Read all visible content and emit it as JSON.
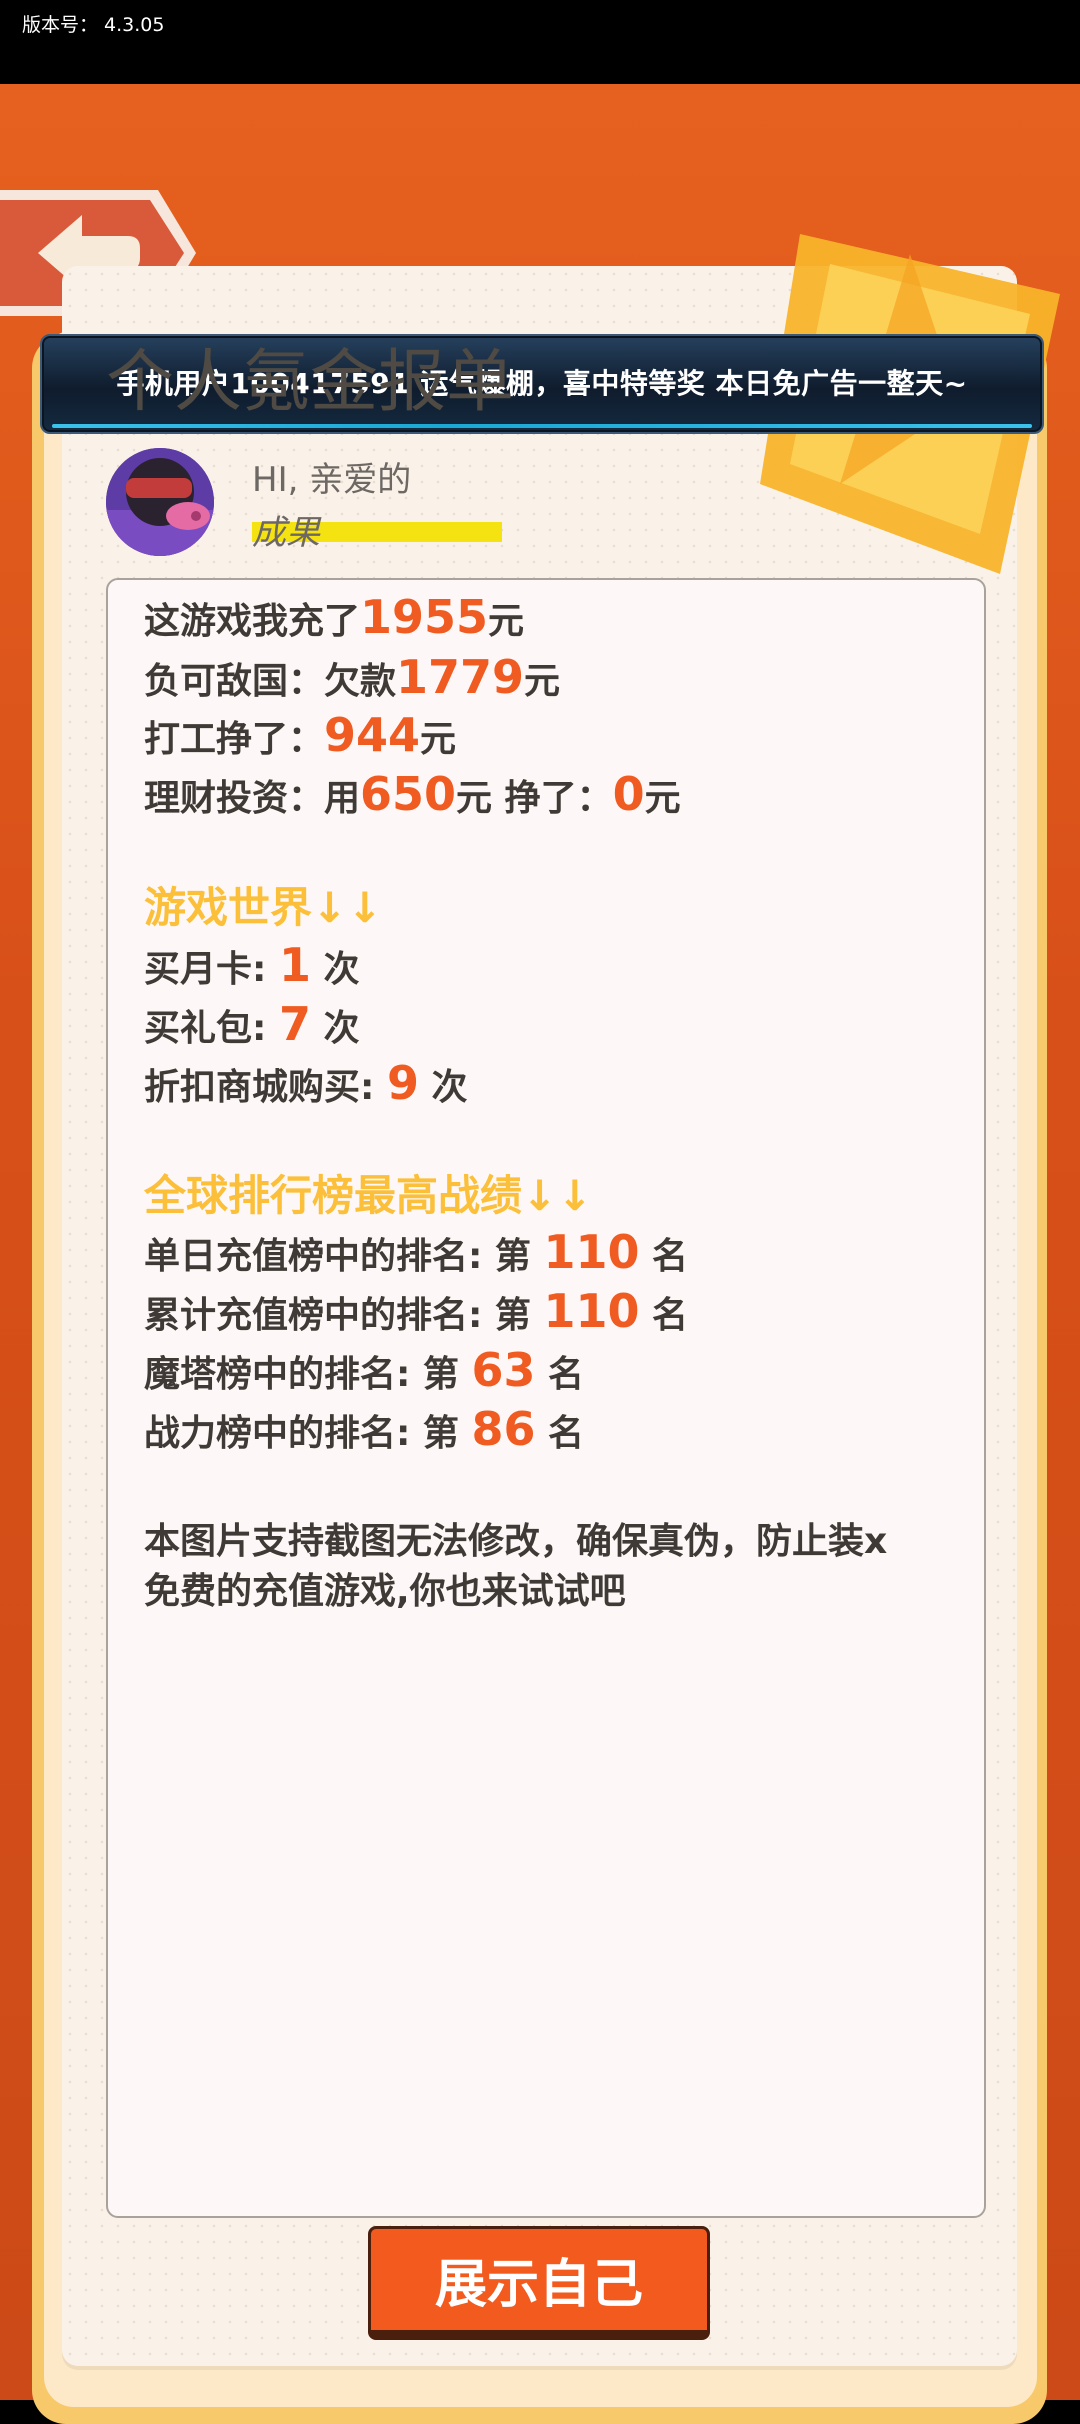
{
  "version_bar": {
    "label": "版本号：  4.3.05"
  },
  "notice": {
    "text": "手机用户100417591 运气爆棚，喜中特等奖 本日免广告一整天~"
  },
  "page": {
    "title": "个人氪金报单"
  },
  "profile": {
    "greeting": "HI, 亲爱的",
    "result_label": "成果"
  },
  "report": {
    "lines": [
      {
        "prefix": "这游戏我充了",
        "value": "1955",
        "suffix": "元"
      },
      {
        "prefix": "负可敌国：欠款",
        "value": "1779",
        "suffix": "元"
      },
      {
        "prefix": "打工挣了：",
        "value": "944",
        "suffix": "元"
      },
      {
        "prefix": "理财投资：用",
        "value": "650",
        "mid": "元 挣了：",
        "value2": "0",
        "suffix": "元"
      }
    ],
    "game_world": {
      "heading": "游戏世界↓↓",
      "items": [
        {
          "prefix": "买月卡: ",
          "value": "1",
          "suffix": " 次"
        },
        {
          "prefix": "买礼包: ",
          "value": "7",
          "suffix": " 次"
        },
        {
          "prefix": "折扣商城购买: ",
          "value": "9",
          "suffix": " 次"
        }
      ]
    },
    "ranking": {
      "heading": "全球排行榜最高战绩↓↓",
      "items": [
        {
          "prefix": "单日充值榜中的排名: 第 ",
          "value": "110",
          "suffix": " 名"
        },
        {
          "prefix": "累计充值榜中的排名: 第 ",
          "value": "110",
          "suffix": " 名"
        },
        {
          "prefix": "魔塔榜中的排名: 第 ",
          "value": "63",
          "suffix": " 名"
        },
        {
          "prefix": "战力榜中的排名: 第 ",
          "value": "86",
          "suffix": " 名"
        }
      ]
    },
    "note_line1": "本图片支持截图无法修改，确保真伪，防止装x",
    "note_line2": "免费的充值游戏,你也来试试吧"
  },
  "button": {
    "label": "展示自己"
  },
  "colors": {
    "accent_orange": "#ef5b20",
    "section_yellow": "#fbbf3a",
    "background": "#d9531c"
  },
  "icons": {
    "back": "back-arrow-icon",
    "avatar": "avatar-character",
    "ticket": "star-ticket-decoration"
  }
}
